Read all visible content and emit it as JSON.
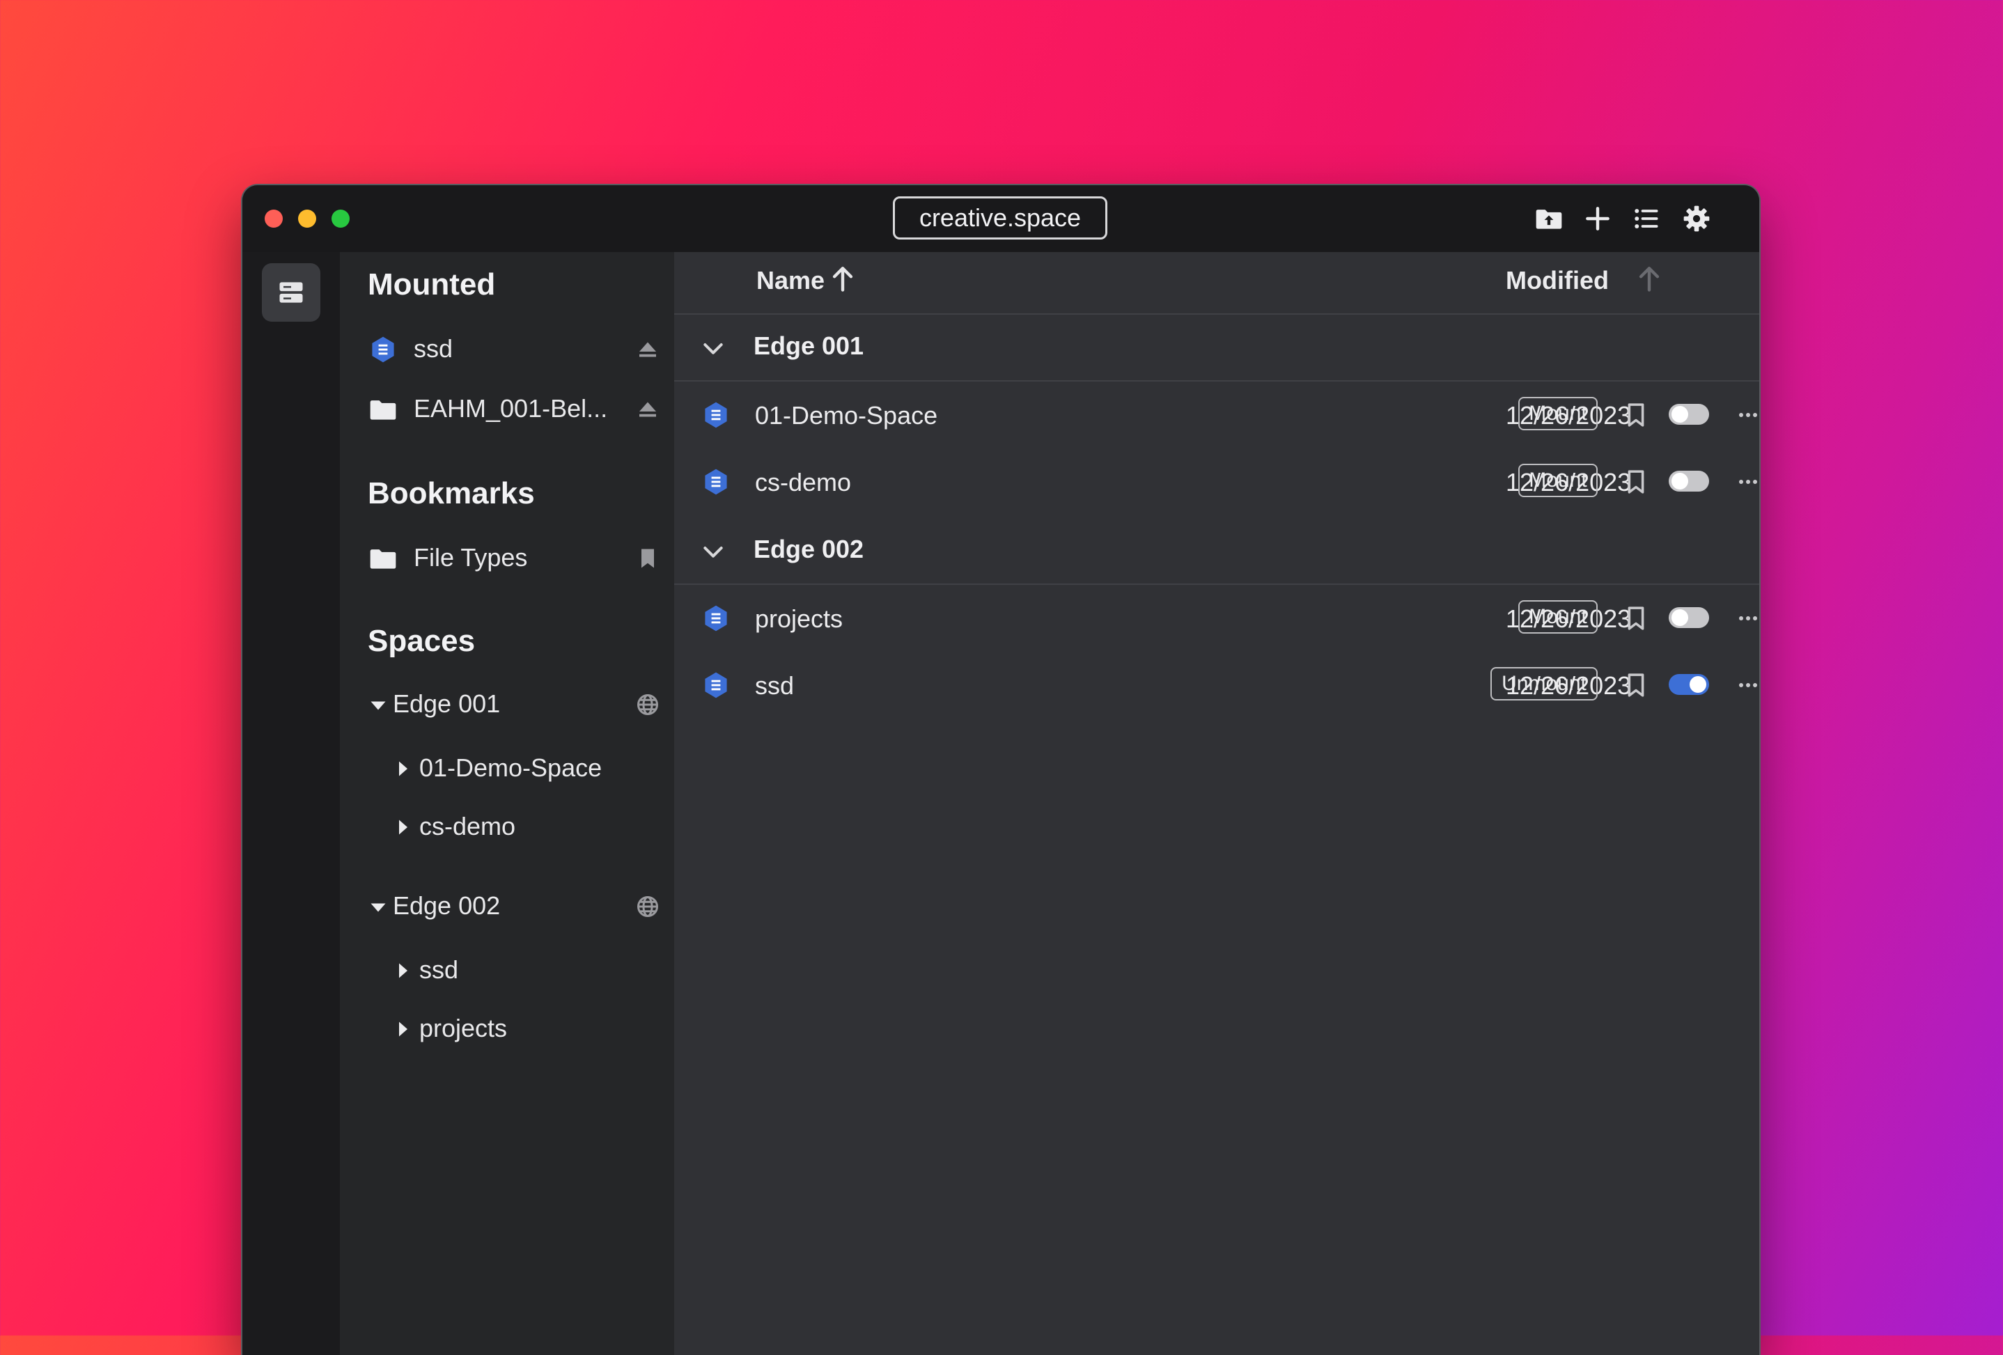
{
  "window": {
    "title": "creative.space",
    "toolbar_icons": [
      "upload-folder-icon",
      "plus-icon",
      "list-view-icon",
      "gear-icon"
    ]
  },
  "sidebar": {
    "sections": [
      {
        "heading": "Mounted",
        "items": [
          {
            "label": "ssd",
            "icon": "volume-icon",
            "action_icon": "eject-icon"
          },
          {
            "label": "EAHM_001-Bel...",
            "icon": "folder-icon",
            "action_icon": "eject-icon"
          }
        ]
      },
      {
        "heading": "Bookmarks",
        "items": [
          {
            "label": "File Types",
            "icon": "folder-icon",
            "action_icon": "bookmark-icon"
          }
        ]
      },
      {
        "heading": "Spaces",
        "groups": [
          {
            "label": "Edge 001",
            "expanded": true,
            "action_icon": "globe-icon",
            "children": [
              "01-Demo-Space",
              "cs-demo"
            ]
          },
          {
            "label": "Edge 002",
            "expanded": true,
            "action_icon": "globe-icon",
            "children": [
              "ssd",
              "projects"
            ]
          }
        ]
      }
    ]
  },
  "table": {
    "columns": {
      "name": "Name",
      "modified": "Modified"
    },
    "sort_column": "Name",
    "groups": [
      {
        "name": "Edge 001",
        "icons": [
          "refresh-icon",
          "globe-icon",
          "sync-settings-icon",
          "avatar"
        ],
        "rows": [
          {
            "name": "01-Demo-Space",
            "modified": "12/26/2023",
            "action": "Mount",
            "toggle_on": false
          },
          {
            "name": "cs-demo",
            "modified": "12/26/2023",
            "action": "Mount",
            "toggle_on": false
          }
        ]
      },
      {
        "name": "Edge 002",
        "icons": [
          "refresh-icon",
          "globe-icon",
          "sync-settings-icon",
          "avatar"
        ],
        "rows": [
          {
            "name": "projects",
            "modified": "12/26/2023",
            "action": "Mount",
            "toggle_on": false
          },
          {
            "name": "ssd",
            "modified": "12/26/2023",
            "action": "Unmount",
            "toggle_on": true
          }
        ]
      }
    ]
  },
  "colors": {
    "accent": "#3d6fd6",
    "window_bg": "#303135",
    "sidebar_bg": "#252628",
    "titlebar_bg": "#19191b"
  }
}
